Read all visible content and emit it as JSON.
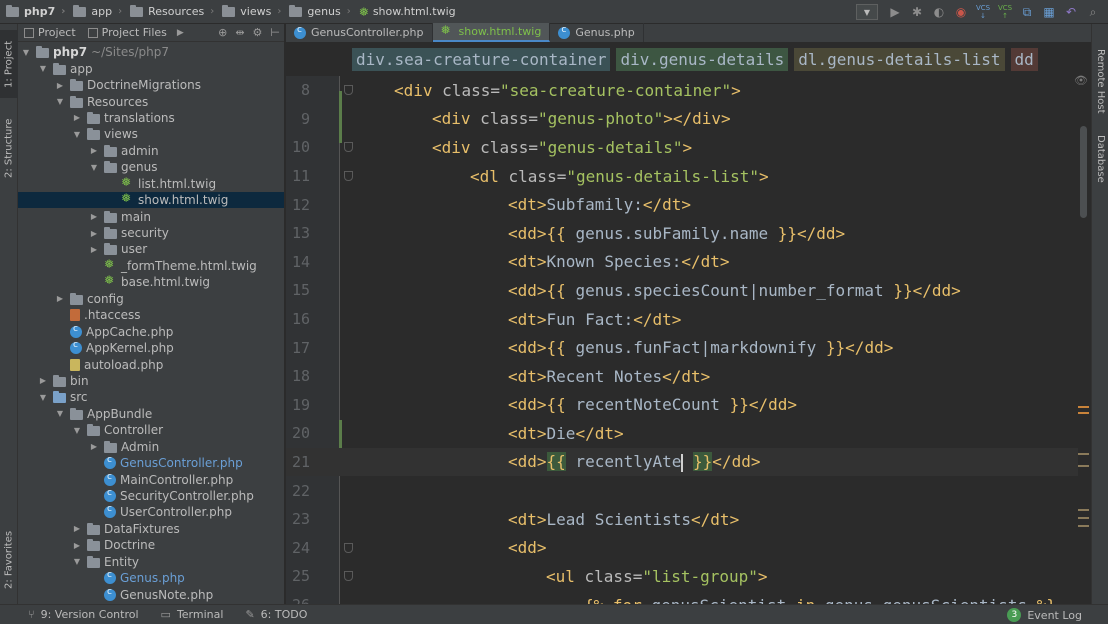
{
  "navbar": {
    "crumbs": [
      {
        "label": "php7",
        "type": "folder",
        "bold": true
      },
      {
        "label": "app",
        "type": "folder"
      },
      {
        "label": "Resources",
        "type": "folder"
      },
      {
        "label": "views",
        "type": "folder"
      },
      {
        "label": "genus",
        "type": "folder"
      },
      {
        "label": "show.html.twig",
        "type": "twig"
      }
    ],
    "toolbar_icons": [
      "run-config-dropdown-icon",
      "run-icon",
      "debug-icon",
      "coverage-icon",
      "profile-icon",
      "vcs-update-icon",
      "vcs-commit-icon",
      "vcs-compare-icon",
      "vcs-history-icon",
      "revert-icon",
      "search-everywhere-icon"
    ],
    "vcs_label": "VCS"
  },
  "left_stripe": {
    "project_tab": "1: Project",
    "structure_tab": "2: Structure",
    "favorites_tab": "2: Favorites"
  },
  "right_stripe": {
    "remote_host_tab": "Remote Host",
    "database_tab": "Database"
  },
  "project_panel": {
    "tabs": [
      "Project",
      "Project Files"
    ],
    "tree": [
      {
        "label": "php7",
        "suffix": "~/Sites/php7",
        "depth": 0,
        "arrow": "open",
        "icon": "folder",
        "bold": true
      },
      {
        "label": "app",
        "depth": 1,
        "arrow": "open",
        "icon": "folder"
      },
      {
        "label": "DoctrineMigrations",
        "depth": 2,
        "arrow": "closed",
        "icon": "folder"
      },
      {
        "label": "Resources",
        "depth": 2,
        "arrow": "open",
        "icon": "folder"
      },
      {
        "label": "translations",
        "depth": 3,
        "arrow": "closed",
        "icon": "folder"
      },
      {
        "label": "views",
        "depth": 3,
        "arrow": "open",
        "icon": "folder"
      },
      {
        "label": "admin",
        "depth": 4,
        "arrow": "closed",
        "icon": "folder"
      },
      {
        "label": "genus",
        "depth": 4,
        "arrow": "open",
        "icon": "folder"
      },
      {
        "label": "list.html.twig",
        "depth": 5,
        "arrow": "none",
        "icon": "twig"
      },
      {
        "label": "show.html.twig",
        "depth": 5,
        "arrow": "none",
        "icon": "twig",
        "selected": true
      },
      {
        "label": "main",
        "depth": 4,
        "arrow": "closed",
        "icon": "folder"
      },
      {
        "label": "security",
        "depth": 4,
        "arrow": "closed",
        "icon": "folder"
      },
      {
        "label": "user",
        "depth": 4,
        "arrow": "closed",
        "icon": "folder"
      },
      {
        "label": "_formTheme.html.twig",
        "depth": 4,
        "arrow": "none",
        "icon": "twig"
      },
      {
        "label": "base.html.twig",
        "depth": 4,
        "arrow": "none",
        "icon": "twig"
      },
      {
        "label": "config",
        "depth": 2,
        "arrow": "closed",
        "icon": "folder"
      },
      {
        "label": ".htaccess",
        "depth": 2,
        "arrow": "none",
        "icon": "hta"
      },
      {
        "label": "AppCache.php",
        "depth": 2,
        "arrow": "none",
        "icon": "php"
      },
      {
        "label": "AppKernel.php",
        "depth": 2,
        "arrow": "none",
        "icon": "php"
      },
      {
        "label": "autoload.php",
        "depth": 2,
        "arrow": "none",
        "icon": "fileyellow"
      },
      {
        "label": "bin",
        "depth": 1,
        "arrow": "closed",
        "icon": "folder"
      },
      {
        "label": "src",
        "depth": 1,
        "arrow": "open",
        "icon": "folderblue"
      },
      {
        "label": "AppBundle",
        "depth": 2,
        "arrow": "open",
        "icon": "folder"
      },
      {
        "label": "Controller",
        "depth": 3,
        "arrow": "open",
        "icon": "folder"
      },
      {
        "label": "Admin",
        "depth": 4,
        "arrow": "closed",
        "icon": "folder"
      },
      {
        "label": "GenusController.php",
        "depth": 4,
        "arrow": "none",
        "icon": "php",
        "color": "blue"
      },
      {
        "label": "MainController.php",
        "depth": 4,
        "arrow": "none",
        "icon": "php"
      },
      {
        "label": "SecurityController.php",
        "depth": 4,
        "arrow": "none",
        "icon": "php"
      },
      {
        "label": "UserController.php",
        "depth": 4,
        "arrow": "none",
        "icon": "php"
      },
      {
        "label": "DataFixtures",
        "depth": 3,
        "arrow": "closed",
        "icon": "folder"
      },
      {
        "label": "Doctrine",
        "depth": 3,
        "arrow": "closed",
        "icon": "folder"
      },
      {
        "label": "Entity",
        "depth": 3,
        "arrow": "open",
        "icon": "folder"
      },
      {
        "label": "Genus.php",
        "depth": 4,
        "arrow": "none",
        "icon": "php",
        "color": "blue"
      },
      {
        "label": "GenusNote.php",
        "depth": 4,
        "arrow": "none",
        "icon": "php"
      }
    ]
  },
  "editor": {
    "tabs": [
      {
        "label": "GenusController.php",
        "icon": "php"
      },
      {
        "label": "show.html.twig",
        "icon": "twig",
        "active": true
      },
      {
        "label": "Genus.php",
        "icon": "php"
      }
    ],
    "tag_breadcrumbs": [
      "div.sea-creature-container",
      "div.genus-details",
      "dl.genus-details-list",
      "dd"
    ],
    "lines": [
      {
        "num": "8",
        "indent": 0,
        "parts": [
          [
            "tag",
            "<div "
          ],
          [
            "attr",
            "class="
          ],
          [
            "str",
            "\"sea-creature-container\""
          ],
          [
            "tag",
            ">"
          ]
        ],
        "fold": true
      },
      {
        "num": "9",
        "indent": 1,
        "parts": [
          [
            "tag",
            "<div "
          ],
          [
            "attr",
            "class="
          ],
          [
            "str",
            "\"genus-photo\""
          ],
          [
            "tag",
            "></div>"
          ]
        ]
      },
      {
        "num": "10",
        "indent": 1,
        "parts": [
          [
            "tag",
            "<div "
          ],
          [
            "attr",
            "class="
          ],
          [
            "str",
            "\"genus-details\""
          ],
          [
            "tag",
            ">"
          ]
        ],
        "fold": true
      },
      {
        "num": "11",
        "indent": 2,
        "parts": [
          [
            "tag",
            "<dl "
          ],
          [
            "attr",
            "class="
          ],
          [
            "str",
            "\"genus-details-list\""
          ],
          [
            "tag",
            ">"
          ]
        ],
        "fold": true
      },
      {
        "num": "12",
        "indent": 3,
        "parts": [
          [
            "tag",
            "<dt>"
          ],
          [
            "txt",
            "Subfamily:"
          ],
          [
            "tag",
            "</dt>"
          ]
        ]
      },
      {
        "num": "13",
        "indent": 3,
        "parts": [
          [
            "tag",
            "<dd>"
          ],
          [
            "tw",
            "{{ "
          ],
          [
            "twv",
            "genus.subFamily.name"
          ],
          [
            "tw",
            " }}"
          ],
          [
            "tag",
            "</dd>"
          ]
        ]
      },
      {
        "num": "14",
        "indent": 3,
        "parts": [
          [
            "tag",
            "<dt>"
          ],
          [
            "txt",
            "Known Species:"
          ],
          [
            "tag",
            "</dt>"
          ]
        ]
      },
      {
        "num": "15",
        "indent": 3,
        "parts": [
          [
            "tag",
            "<dd>"
          ],
          [
            "tw",
            "{{ "
          ],
          [
            "twv",
            "genus.speciesCount|number_format"
          ],
          [
            "tw",
            " }}"
          ],
          [
            "tag",
            "</dd>"
          ]
        ]
      },
      {
        "num": "16",
        "indent": 3,
        "parts": [
          [
            "tag",
            "<dt>"
          ],
          [
            "txt",
            "Fun Fact:"
          ],
          [
            "tag",
            "</dt>"
          ]
        ]
      },
      {
        "num": "17",
        "indent": 3,
        "parts": [
          [
            "tag",
            "<dd>"
          ],
          [
            "tw",
            "{{ "
          ],
          [
            "twv",
            "genus.funFact|markdownify"
          ],
          [
            "tw",
            " }}"
          ],
          [
            "tag",
            "</dd>"
          ]
        ]
      },
      {
        "num": "18",
        "indent": 3,
        "parts": [
          [
            "tag",
            "<dt>"
          ],
          [
            "txt",
            "Recent Notes"
          ],
          [
            "tag",
            "</dt>"
          ]
        ]
      },
      {
        "num": "19",
        "indent": 3,
        "parts": [
          [
            "tag",
            "<dd>"
          ],
          [
            "tw",
            "{{ "
          ],
          [
            "twv",
            "recentNoteCount"
          ],
          [
            "tw",
            " }}"
          ],
          [
            "tag",
            "</dd>"
          ]
        ]
      },
      {
        "num": "20",
        "indent": 3,
        "parts": [
          [
            "tag",
            "<dt>"
          ],
          [
            "txt",
            "Die"
          ],
          [
            "tag",
            "</dt>"
          ]
        ]
      },
      {
        "num": "21",
        "indent": 3,
        "parts": [
          [
            "tag",
            "<dd>"
          ],
          [
            "twh",
            "{{"
          ],
          [
            "twv",
            " recentlyAte"
          ],
          [
            "caret",
            ""
          ],
          [
            "twv",
            " "
          ],
          [
            "twh",
            "}}"
          ],
          [
            "tag",
            "</dd>"
          ]
        ],
        "current": true
      },
      {
        "num": "22",
        "indent": 0,
        "parts": []
      },
      {
        "num": "23",
        "indent": 3,
        "parts": [
          [
            "tag",
            "<dt>"
          ],
          [
            "txt",
            "Lead Scientists"
          ],
          [
            "tag",
            "</dt>"
          ]
        ]
      },
      {
        "num": "24",
        "indent": 3,
        "parts": [
          [
            "tag",
            "<dd>"
          ]
        ],
        "fold": true
      },
      {
        "num": "25",
        "indent": 4,
        "parts": [
          [
            "tag",
            "<ul "
          ],
          [
            "attr",
            "class="
          ],
          [
            "str",
            "\"list-group\""
          ],
          [
            "tag",
            ">"
          ]
        ],
        "fold": true
      },
      {
        "num": "26",
        "indent": 5,
        "parts": [
          [
            "tw",
            "{% "
          ],
          [
            "twk",
            "for "
          ],
          [
            "twv",
            "genusScientist "
          ],
          [
            "twk",
            "in "
          ],
          [
            "twv",
            "genus.genusScientists "
          ],
          [
            "tw",
            "%}"
          ]
        ]
      }
    ]
  },
  "statusbar": {
    "version_control": "9: Version Control",
    "terminal": "Terminal",
    "todo": "6: TODO",
    "event_log": "Event Log",
    "event_count": "3"
  }
}
